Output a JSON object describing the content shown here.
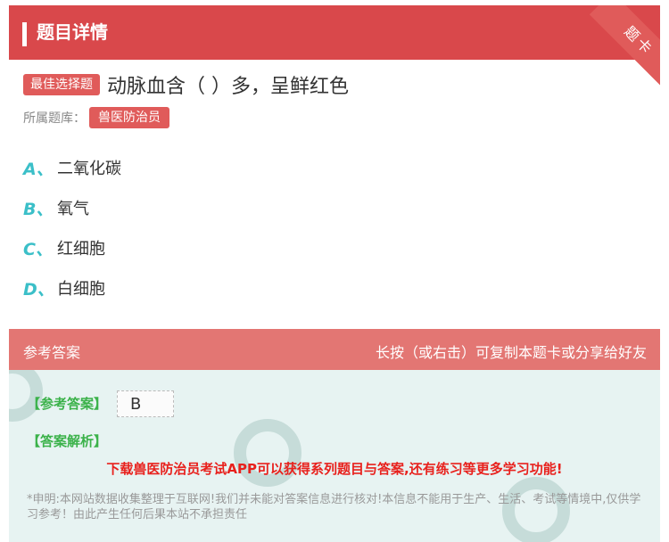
{
  "header": {
    "title": "题目详情",
    "corner_label": "题卡"
  },
  "question": {
    "type_tag": "最佳选择题",
    "text": "动脉血含（ ）多，呈鲜红色",
    "bank_label": "所属题库：",
    "bank_name": "兽医防治员"
  },
  "options": [
    {
      "letter": "A、",
      "text": "二氧化碳"
    },
    {
      "letter": "B、",
      "text": "氧气"
    },
    {
      "letter": "C、",
      "text": "红细胞"
    },
    {
      "letter": "D、",
      "text": "白细胞"
    }
  ],
  "answer": {
    "section_title": "参考答案",
    "copy_hint": "长按（或右击）可复制本题卡或分享给好友",
    "ref_label": "【参考答案】",
    "ref_value": "B",
    "explain_label": "【答案解析】",
    "promo": "下载兽医防治员考试APP可以获得系列题目与答案,还有练习等更多学习功能!",
    "notice": "*申明:本网站数据收集整理于互联网!我们并未能对答案信息进行核对!本信息不能用于生产、生活、考试等情境中,仅供学习参考！由此产生任何后果本站不承担责任"
  },
  "colors": {
    "header": "#d9484b",
    "tag": "#e05b5a",
    "option_letter": "#3bbfc8",
    "answer_head": "#e37673",
    "answer_body": "#e7f3f2",
    "label_green": "#3bb24a",
    "promo_red": "#e8211d"
  }
}
